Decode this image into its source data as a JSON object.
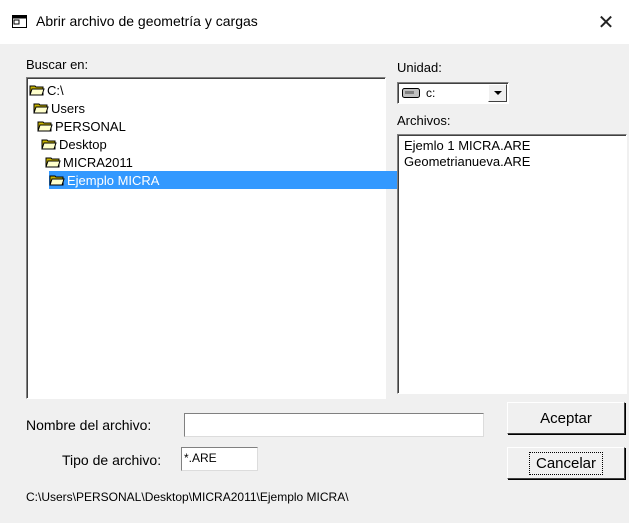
{
  "window": {
    "title": "Abrir archivo de geometría y cargas",
    "close_glyph": "✕",
    "icon": "window-app-icon"
  },
  "left_panel": {
    "label": "Buscar en:",
    "tree": [
      {
        "label": "C:\\",
        "icon": "open-folder-icon"
      },
      {
        "label": "Users",
        "icon": "open-folder-icon"
      },
      {
        "label": "PERSONAL",
        "icon": "open-folder-icon"
      },
      {
        "label": "Desktop",
        "icon": "open-folder-icon"
      },
      {
        "label": "MICRA2011",
        "icon": "open-folder-icon"
      },
      {
        "label": "Ejemplo MICRA",
        "icon": "open-folder-icon",
        "selected": true
      }
    ]
  },
  "right_panel": {
    "drive_label": "Unidad:",
    "drive_value": "c:",
    "drive_icon": "drive-icon",
    "files_label": "Archivos:",
    "files": [
      "Ejemlo 1 MICRA.ARE",
      "Geometrianueva.ARE"
    ]
  },
  "form": {
    "filename_label": "Nombre del archivo:",
    "filename_value": "",
    "filetype_label": "Tipo de archivo:",
    "filetype_value": "*.ARE"
  },
  "buttons": {
    "accept": "Aceptar",
    "cancel": "Cancelar"
  },
  "status_path": "C:\\Users\\PERSONAL\\Desktop\\MICRA2011\\Ejemplo MICRA\\",
  "colors": {
    "selection": "#3399ff",
    "dialog_bg": "#f0f0f0",
    "titlebar_bg": "#ffffff"
  }
}
